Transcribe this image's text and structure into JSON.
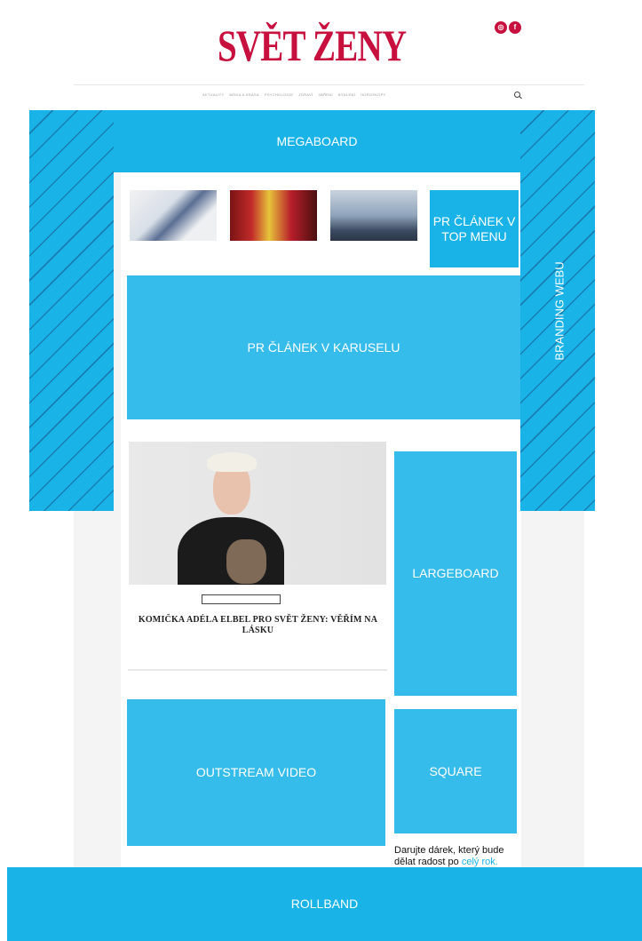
{
  "header": {
    "logo": "SVĚT ŽENY",
    "social": [
      "instagram-icon",
      "facebook-icon"
    ],
    "nav": [
      "AKTUALITY",
      "MÓDA A KRÁSA",
      "PSYCHOLOGIE",
      "ZDRAVÍ",
      "VAŘENÍ",
      "BYDLENÍ",
      "HOROSKOPY"
    ]
  },
  "ads": {
    "megaboard": "MEGABOARD",
    "branding": "BRANDING WEBU",
    "pr_top_menu": "PR ČLÁNEK V TOP MENU",
    "pr_carousel": "PR ČLÁNEK V KARUSELU",
    "largeboard": "LARGEBOARD",
    "outstream": "OUTSTREAM VIDEO",
    "square": "SQUARE",
    "rollband": "ROLLBAND"
  },
  "thumbnails": [
    {
      "caption": ""
    },
    {
      "caption": ""
    },
    {
      "caption": ""
    }
  ],
  "main_article": {
    "tag": "",
    "headline": "KOMIČKA ADÉLA ELBEL PRO SVĚT ŽENY: VĚŘÍM NA LÁSKU",
    "perex": ""
  },
  "sidebar": {
    "headline_text": "Darujte dárek, který bude dělat radost po",
    "headline_link": "celý rok. Darujte předplatné!"
  },
  "colors": {
    "brand": "#c8103e",
    "ad_placeholder": "#1ab3e8"
  }
}
